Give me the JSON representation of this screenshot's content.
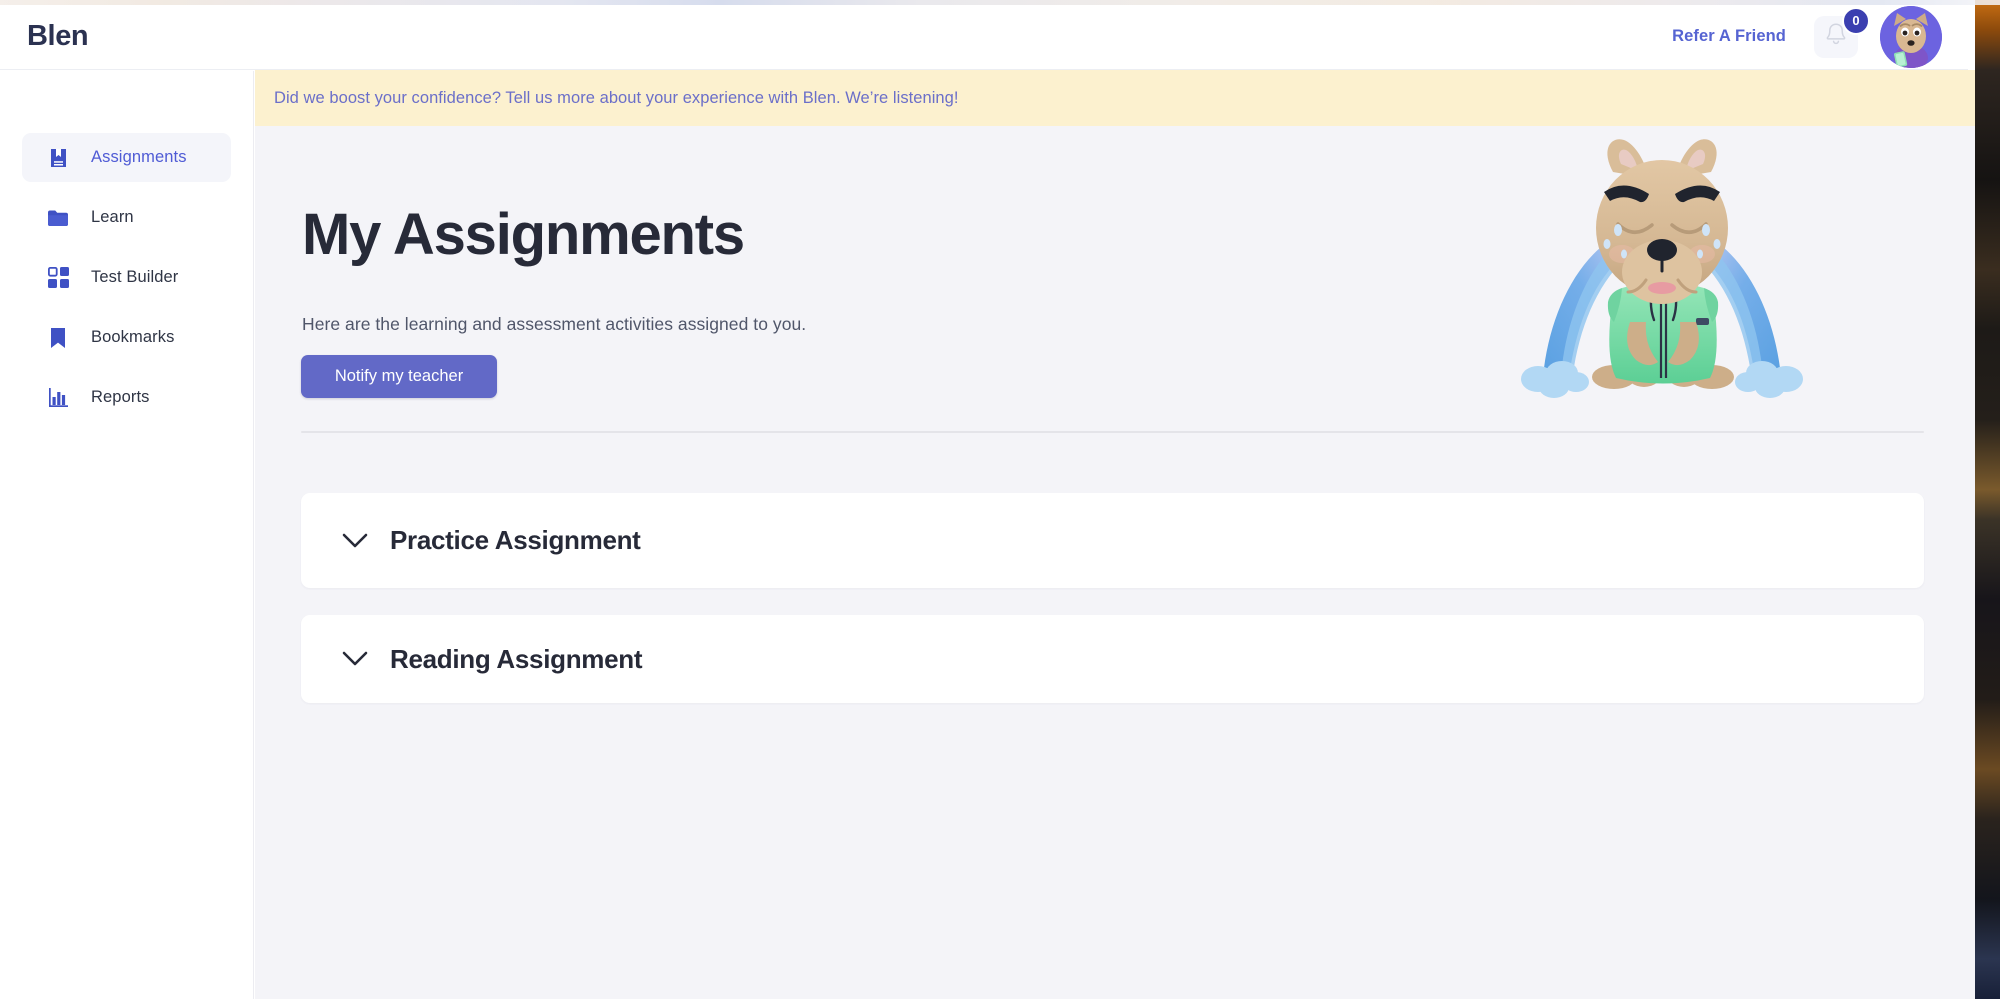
{
  "app": {
    "logo_text": "Blen",
    "brand_color": "#5664d2",
    "accent_button_color": "#6269c7",
    "banner_bg_color": "#fcf1cf",
    "content_bg_color": "#f4f4f8"
  },
  "topbar": {
    "refer_label": "Refer A Friend",
    "bell_icon": "bell-icon",
    "notification_count": "0",
    "avatar_icon": "dog-avatar"
  },
  "sidebar": {
    "items": [
      {
        "label": "Assignments",
        "icon": "book-bookmark-icon",
        "active": true
      },
      {
        "label": "Learn",
        "icon": "folder-icon",
        "active": false
      },
      {
        "label": "Test Builder",
        "icon": "grid-squares-icon",
        "active": false
      },
      {
        "label": "Bookmarks",
        "icon": "bookmark-flag-icon",
        "active": false
      },
      {
        "label": "Reports",
        "icon": "bar-chart-icon",
        "active": false
      }
    ]
  },
  "banner": {
    "message": "Did we boost your confidence? Tell us more about your experience with Blen. We’re listening!"
  },
  "main": {
    "title": "My Assignments",
    "subtitle": "Here are the learning and assessment activities assigned to you.",
    "notify_button_label": "Notify my teacher",
    "mascot_icon": "crying-dog-mascot",
    "sections": [
      {
        "title": "Practice Assignment",
        "chevron_icon": "chevron-down-icon",
        "expanded": false
      },
      {
        "title": "Reading Assignment",
        "chevron_icon": "chevron-down-icon",
        "expanded": false
      }
    ]
  }
}
